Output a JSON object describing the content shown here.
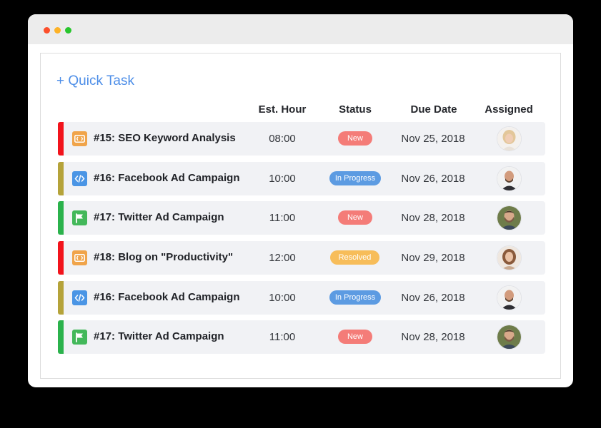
{
  "header": {
    "quick_task_label": "+ Quick Task"
  },
  "columns": {
    "est_hour": "Est. Hour",
    "status": "Status",
    "due_date": "Due Date",
    "assigned": "Assigned"
  },
  "colors": {
    "accent": "#4d8ee8",
    "priority_red": "#f2141c",
    "priority_olive": "#b5a33a",
    "priority_green": "#2bb24c",
    "status_new": "#f47c78",
    "status_in_progress": "#5c9be2",
    "status_resolved": "#f7bd5a"
  },
  "tasks": [
    {
      "title": "#15: SEO Keyword Analysis",
      "hour": "08:00",
      "status": "New",
      "due": "Nov 25, 2018",
      "icon": "bracket-task-icon",
      "priority": "red",
      "avatar": "blonde-woman-avatar"
    },
    {
      "title": "#16: Facebook Ad Campaign",
      "hour": "10:00",
      "status": "In Progress",
      "due": "Nov 26, 2018",
      "icon": "code-icon",
      "priority": "olive",
      "avatar": "bald-man-avatar"
    },
    {
      "title": "#17: Twitter Ad Campaign",
      "hour": "11:00",
      "status": "New",
      "due": "Nov 28, 2018",
      "icon": "flag-icon",
      "priority": "green",
      "avatar": "bearded-man-avatar"
    },
    {
      "title": "#18: Blog on \"Productivity\"",
      "hour": "12:00",
      "status": "Resolved",
      "due": "Nov 29, 2018",
      "icon": "bracket-task-icon",
      "priority": "red",
      "avatar": "brunette-woman-avatar"
    },
    {
      "title": "#16: Facebook Ad Campaign",
      "hour": "10:00",
      "status": "In Progress",
      "due": "Nov 26, 2018",
      "icon": "code-icon",
      "priority": "olive",
      "avatar": "bald-man-avatar"
    },
    {
      "title": "#17: Twitter Ad Campaign",
      "hour": "11:00",
      "status": "New",
      "due": "Nov 28, 2018",
      "icon": "flag-icon",
      "priority": "green",
      "avatar": "bearded-man-avatar"
    }
  ]
}
